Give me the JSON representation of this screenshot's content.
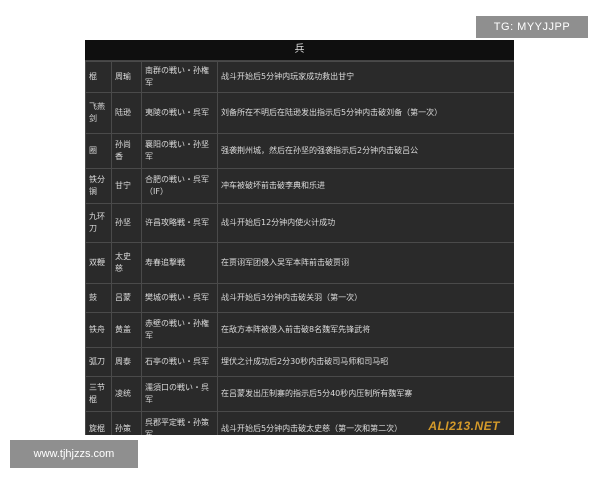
{
  "badges": {
    "tg": "TG: MYYJJPP",
    "url": "www.tjhjzzs.com"
  },
  "table": {
    "title": "兵",
    "rows": [
      [
        "棍",
        "周瑜",
        "南群の戦い・孙権军",
        "战斗开始后5分钟内玩家成功救出甘宁"
      ],
      [
        "飞燕剑",
        "陆逊",
        "夷陵の戦い・呉军",
        "刘备所在不明后在陆逊发出指示后5分钟内击破刘备（第一次）"
      ],
      [
        "圈",
        "孙尚香",
        "襄阳の戦い・孙坚军",
        "强袭荆州城，然后在孙坚的强袭指示后2分钟内击破吕公"
      ],
      [
        "铁分锏",
        "甘宁",
        "合肥の戦い・呉军（IF）",
        "冲车被破坏前击破李典和乐进"
      ],
      [
        "九环刀",
        "孙坚",
        "许昌攻略戦・呉军",
        "战斗开始后12分钟内使火计成功"
      ],
      [
        "双鞭",
        "太史慈",
        "寿春追撃戦",
        "在贾诩军团侵入吴军本阵前击破贾诩"
      ],
      [
        "鼓",
        "吕蒙",
        "樊城の戦い・呉军",
        "战斗开始后3分钟内击破关羽（第一次）"
      ],
      [
        "铁舟",
        "黄盖",
        "赤壁の戦い・孙権军",
        "在敌方本阵被侵入前击破8名魏军先锋武将"
      ],
      [
        "弧刀",
        "周泰",
        "石亭の戦い・呉军",
        "埋伏之计成功后2分30秒内击破司马师和司马昭"
      ],
      [
        "三节棍",
        "凌统",
        "濡須口の戦い・呉军",
        "在吕蒙发出压制寨的指示后5分40秒内压制所有魏军寨"
      ],
      [
        "旋棍",
        "孙策",
        "呉郡平定戦・孙策军",
        "战斗开始后5分钟内击破太史慈（第一次和第二次）"
      ]
    ]
  },
  "watermark": "ALI213.NET"
}
